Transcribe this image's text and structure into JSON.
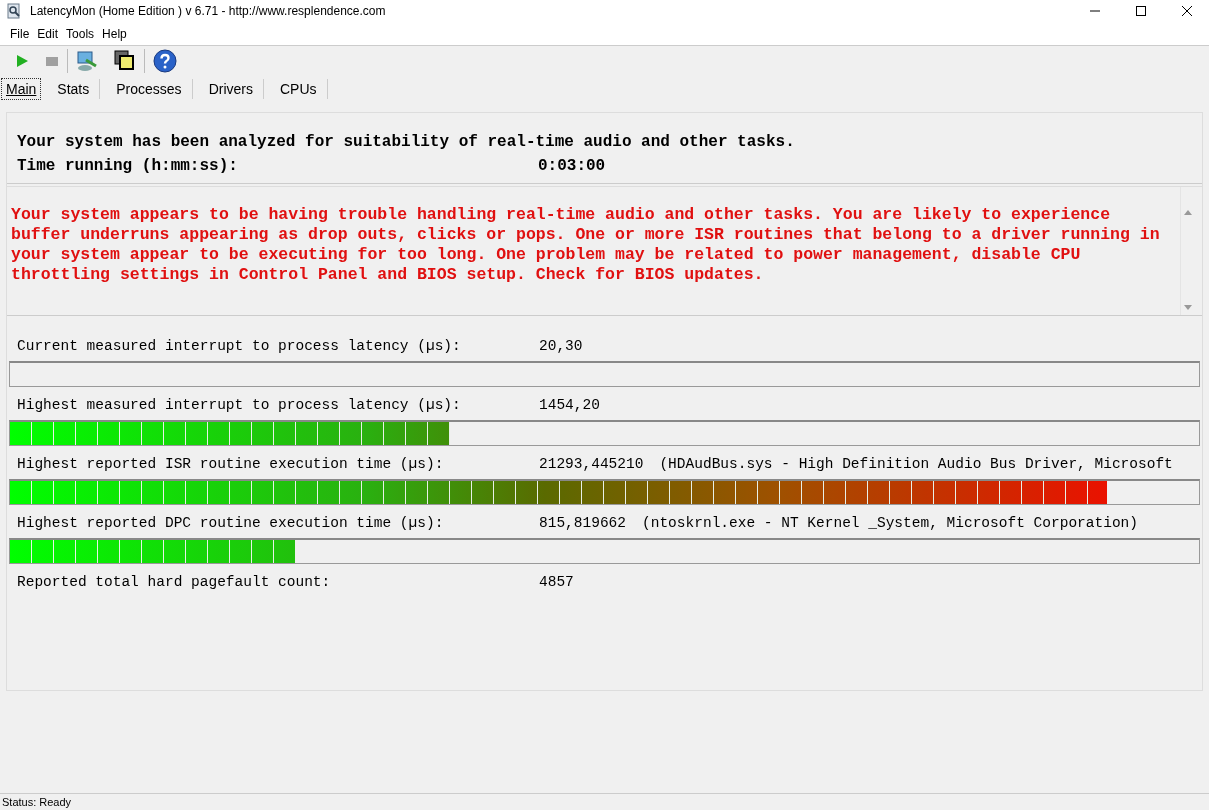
{
  "window": {
    "title": "LatencyMon  (Home Edition )  v 6.71 - http://www.resplendence.com"
  },
  "menu": [
    "File",
    "Edit",
    "Tools",
    "Help"
  ],
  "tabs": [
    {
      "label": "Main",
      "selected": true
    },
    {
      "label": "Stats",
      "selected": false
    },
    {
      "label": "Processes",
      "selected": false
    },
    {
      "label": "Drivers",
      "selected": false
    },
    {
      "label": "CPUs",
      "selected": false
    }
  ],
  "summary": {
    "headline": "Your system has been analyzed for suitability of real-time audio and other tasks.",
    "time_label": "Time running (h:mm:ss):",
    "time_value": "0:03:00"
  },
  "verdict": "Your system appears to be having trouble handling real-time audio and other tasks. You are likely to experience buffer underruns appearing as drop outs, clicks or pops. One or more ISR routines that belong to a driver running in your system appear to be executing for too long. One problem may be related to power management, disable CPU throttling settings in Control Panel and BIOS setup. Check for BIOS updates.",
  "measurements": [
    {
      "label": "Current measured interrupt to process latency (µs):",
      "value": "20,30",
      "level": 0
    },
    {
      "label": "Highest measured interrupt to process latency (µs):",
      "value": "1454,20",
      "level": 0.37
    },
    {
      "label": "Highest reported ISR routine execution time (µs):",
      "value": "21293,445210",
      "detail": "(HDAudBus.sys - High Definition Audio Bus Driver, Microsoft",
      "level": 0.923
    },
    {
      "label": "Highest reported DPC routine execution time (µs):",
      "value": "815,819662",
      "detail": "(ntoskrnl.exe - NT Kernel _System, Microsoft Corporation)",
      "level": 0.24
    },
    {
      "label": "Reported total hard pagefault count:",
      "value": "4857"
    }
  ],
  "status_bar": "Status: Ready"
}
